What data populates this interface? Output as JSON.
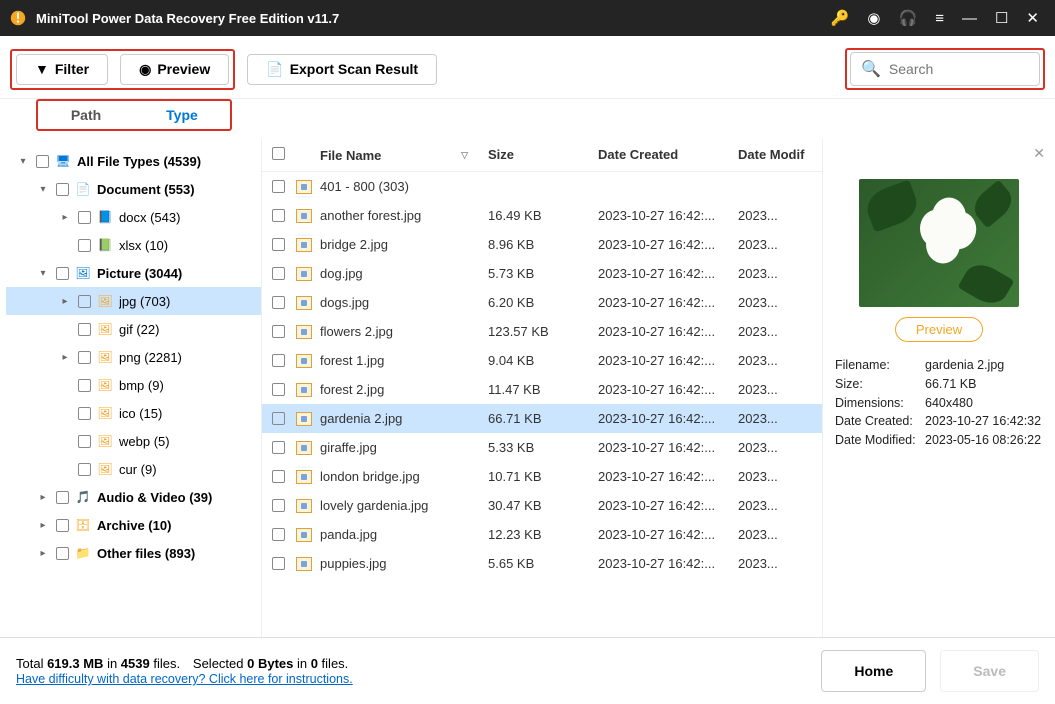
{
  "title": "MiniTool Power Data Recovery Free Edition v11.7",
  "toolbar": {
    "filter": "Filter",
    "preview": "Preview",
    "export": "Export Scan Result",
    "search_placeholder": "Search"
  },
  "tabs": {
    "path": "Path",
    "type": "Type"
  },
  "tree": [
    {
      "indent": 1,
      "chev": "▾",
      "bold": true,
      "icon": "monitor",
      "iconClass": "ic-blue",
      "label": "All File Types (4539)"
    },
    {
      "indent": 2,
      "chev": "▾",
      "bold": true,
      "icon": "doc",
      "iconClass": "ic-blue",
      "label": "Document (553)"
    },
    {
      "indent": 3,
      "chev": "▸",
      "bold": false,
      "icon": "docx",
      "iconClass": "ic-blue",
      "label": "docx (543)"
    },
    {
      "indent": 3,
      "chev": "",
      "bold": false,
      "icon": "xlsx",
      "iconClass": "ic-green",
      "label": "xlsx (10)"
    },
    {
      "indent": 2,
      "chev": "▾",
      "bold": true,
      "icon": "picture",
      "iconClass": "ic-blue",
      "label": "Picture (3044)"
    },
    {
      "indent": 3,
      "chev": "▸",
      "bold": false,
      "icon": "img",
      "iconClass": "ic-orange",
      "label": "jpg (703)",
      "sel": true
    },
    {
      "indent": 3,
      "chev": "",
      "bold": false,
      "icon": "img",
      "iconClass": "ic-orange",
      "label": "gif (22)"
    },
    {
      "indent": 3,
      "chev": "▸",
      "bold": false,
      "icon": "img",
      "iconClass": "ic-orange",
      "label": "png (2281)"
    },
    {
      "indent": 3,
      "chev": "",
      "bold": false,
      "icon": "img",
      "iconClass": "ic-orange",
      "label": "bmp (9)"
    },
    {
      "indent": 3,
      "chev": "",
      "bold": false,
      "icon": "img",
      "iconClass": "ic-orange",
      "label": "ico (15)"
    },
    {
      "indent": 3,
      "chev": "",
      "bold": false,
      "icon": "img",
      "iconClass": "ic-orange",
      "label": "webp (5)"
    },
    {
      "indent": 3,
      "chev": "",
      "bold": false,
      "icon": "img",
      "iconClass": "ic-orange",
      "label": "cur (9)"
    },
    {
      "indent": 2,
      "chev": "▸",
      "bold": true,
      "icon": "audio",
      "iconClass": "ic-blue",
      "label": "Audio & Video (39)"
    },
    {
      "indent": 2,
      "chev": "▸",
      "bold": true,
      "icon": "archive",
      "iconClass": "ic-orange",
      "label": "Archive (10)"
    },
    {
      "indent": 2,
      "chev": "▸",
      "bold": true,
      "icon": "other",
      "iconClass": "ic-orange",
      "label": "Other files (893)"
    }
  ],
  "columns": {
    "name": "File Name",
    "size": "Size",
    "created": "Date Created",
    "modified": "Date Modif"
  },
  "files": [
    {
      "name": "401 - 800 (303)",
      "size": "",
      "created": "",
      "modified": ""
    },
    {
      "name": "another forest.jpg",
      "size": "16.49 KB",
      "created": "2023-10-27 16:42:...",
      "modified": "2023..."
    },
    {
      "name": "bridge 2.jpg",
      "size": "8.96 KB",
      "created": "2023-10-27 16:42:...",
      "modified": "2023..."
    },
    {
      "name": "dog.jpg",
      "size": "5.73 KB",
      "created": "2023-10-27 16:42:...",
      "modified": "2023..."
    },
    {
      "name": "dogs.jpg",
      "size": "6.20 KB",
      "created": "2023-10-27 16:42:...",
      "modified": "2023..."
    },
    {
      "name": "flowers 2.jpg",
      "size": "123.57 KB",
      "created": "2023-10-27 16:42:...",
      "modified": "2023..."
    },
    {
      "name": "forest 1.jpg",
      "size": "9.04 KB",
      "created": "2023-10-27 16:42:...",
      "modified": "2023..."
    },
    {
      "name": "forest 2.jpg",
      "size": "11.47 KB",
      "created": "2023-10-27 16:42:...",
      "modified": "2023..."
    },
    {
      "name": "gardenia 2.jpg",
      "size": "66.71 KB",
      "created": "2023-10-27 16:42:...",
      "modified": "2023...",
      "sel": true
    },
    {
      "name": "giraffe.jpg",
      "size": "5.33 KB",
      "created": "2023-10-27 16:42:...",
      "modified": "2023..."
    },
    {
      "name": "london bridge.jpg",
      "size": "10.71 KB",
      "created": "2023-10-27 16:42:...",
      "modified": "2023..."
    },
    {
      "name": "lovely gardenia.jpg",
      "size": "30.47 KB",
      "created": "2023-10-27 16:42:...",
      "modified": "2023..."
    },
    {
      "name": "panda.jpg",
      "size": "12.23 KB",
      "created": "2023-10-27 16:42:...",
      "modified": "2023..."
    },
    {
      "name": "puppies.jpg",
      "size": "5.65 KB",
      "created": "2023-10-27 16:42:...",
      "modified": "2023..."
    }
  ],
  "preview": {
    "button": "Preview",
    "meta": [
      {
        "k": "Filename:",
        "v": "gardenia 2.jpg"
      },
      {
        "k": "Size:",
        "v": "66.71 KB"
      },
      {
        "k": "Dimensions:",
        "v": "640x480"
      },
      {
        "k": "Date Created:",
        "v": "2023-10-27 16:42:32"
      },
      {
        "k": "Date Modified:",
        "v": "2023-05-16 08:26:22"
      }
    ]
  },
  "bottom": {
    "total_pre": "Total ",
    "total_size": "619.3 MB",
    "total_mid": " in ",
    "total_files": "4539",
    "total_post": " files.",
    "sel_pre": "Selected ",
    "sel_bytes": "0 Bytes",
    "sel_mid": " in ",
    "sel_files": "0",
    "sel_post": " files.",
    "link": "Have difficulty with data recovery? Click here for instructions.",
    "home": "Home",
    "save": "Save"
  }
}
